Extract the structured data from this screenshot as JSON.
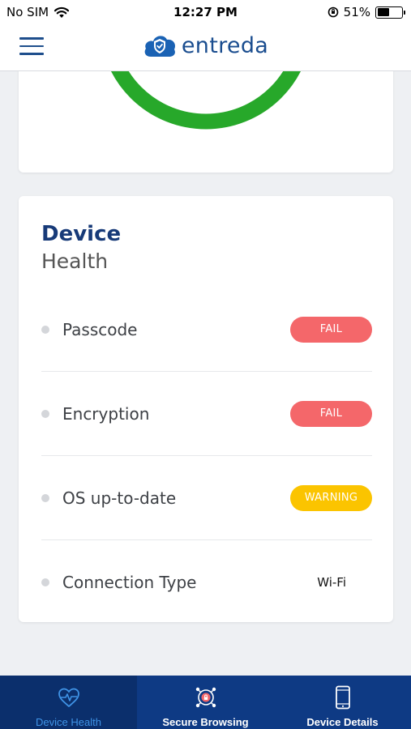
{
  "status_bar": {
    "carrier": "No SIM",
    "time": "12:27 PM",
    "battery": "51%",
    "battery_level": 0.51
  },
  "header": {
    "brand": "entreda",
    "menu_icon": "hamburger-menu-icon",
    "logo_icon": "cloud-shield-icon"
  },
  "device_health": {
    "title_strong": "Device",
    "title_light": "Health",
    "items": [
      {
        "label": "Passcode",
        "status": "FAIL",
        "kind": "fail"
      },
      {
        "label": "Encryption",
        "status": "FAIL",
        "kind": "fail"
      },
      {
        "label": "OS up-to-date",
        "status": "WARNING",
        "kind": "warning"
      },
      {
        "label": "Connection Type",
        "status": "Wi-Fi",
        "kind": "plain"
      }
    ]
  },
  "score_ring": {
    "color": "#27a82a"
  },
  "colors": {
    "fail": "#f4676a",
    "warning": "#fbc400",
    "brand": "#1a4d8f",
    "tab_bar": "#0e3a84",
    "tab_active_text": "#3f93e6"
  },
  "tabs": [
    {
      "label": "Device Health",
      "icon": "heart-pulse-icon",
      "active": true
    },
    {
      "label": "Secure Browsing",
      "icon": "secure-browsing-icon",
      "active": false
    },
    {
      "label": "Device Details",
      "icon": "phone-icon",
      "active": false
    }
  ]
}
